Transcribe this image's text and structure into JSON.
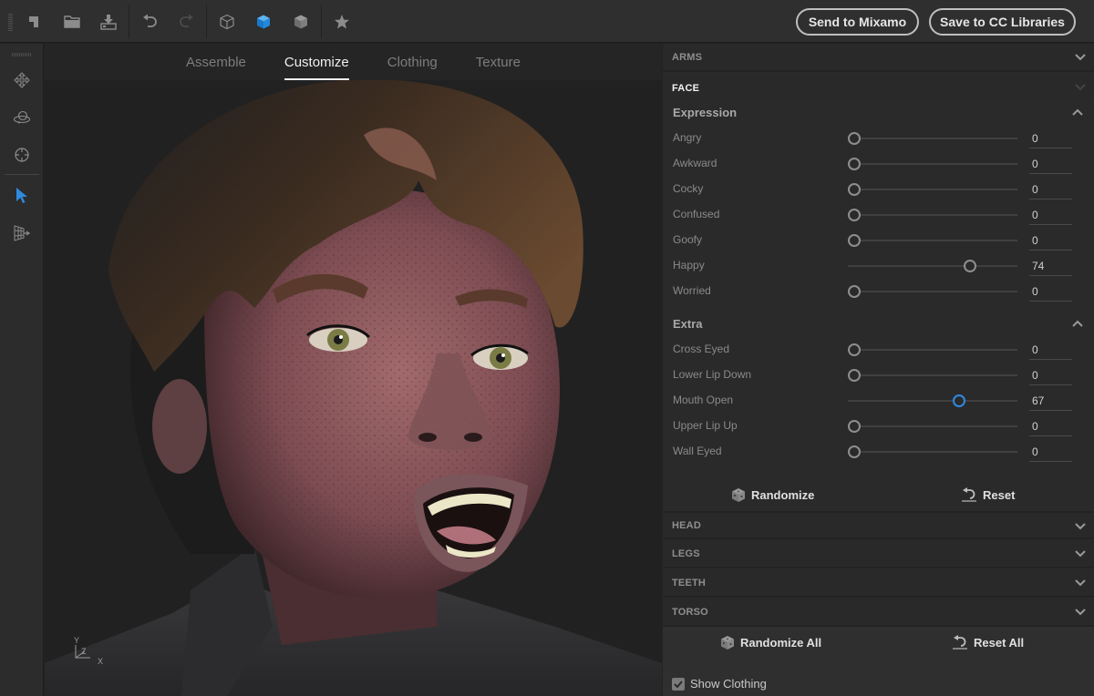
{
  "toolbar": {
    "icons": [
      "new-document-icon",
      "open-folder-icon",
      "import-icon",
      "undo-icon",
      "redo-icon",
      "wireframe-cube-icon",
      "shaded-cube-icon",
      "solid-cube-icon",
      "favorite-star-icon"
    ],
    "send_label": "Send to Mixamo",
    "save_label": "Save to CC Libraries"
  },
  "rail": {
    "icons": [
      "pan-icon",
      "orbit-icon",
      "target-icon",
      "select-arrow-icon",
      "perspective-grid-icon"
    ],
    "active": "select-arrow-icon"
  },
  "viewport": {
    "tabs": [
      {
        "label": "Assemble",
        "active": false
      },
      {
        "label": "Customize",
        "active": true
      },
      {
        "label": "Clothing",
        "active": false
      },
      {
        "label": "Texture",
        "active": false
      }
    ],
    "axes": {
      "y": "Y",
      "z": "Z",
      "x": "X"
    }
  },
  "panel": {
    "sections_top": [
      {
        "label": "ARMS",
        "open": false
      },
      {
        "label": "FACE",
        "open": true
      }
    ],
    "expression": {
      "title": "Expression",
      "sliders": [
        {
          "label": "Angry",
          "value": 0
        },
        {
          "label": "Awkward",
          "value": 0
        },
        {
          "label": "Cocky",
          "value": 0
        },
        {
          "label": "Confused",
          "value": 0
        },
        {
          "label": "Goofy",
          "value": 0
        },
        {
          "label": "Happy",
          "value": 74
        },
        {
          "label": "Worried",
          "value": 0
        }
      ]
    },
    "extra": {
      "title": "Extra",
      "sliders": [
        {
          "label": "Cross Eyed",
          "value": 0
        },
        {
          "label": "Lower Lip Down",
          "value": 0
        },
        {
          "label": "Mouth Open",
          "value": 67,
          "active": true
        },
        {
          "label": "Upper Lip Up",
          "value": 0
        },
        {
          "label": "Wall Eyed",
          "value": 0
        }
      ]
    },
    "face_actions": {
      "randomize": "Randomize",
      "reset": "Reset"
    },
    "sections_bottom": [
      {
        "label": "HEAD",
        "open": false
      },
      {
        "label": "LEGS",
        "open": false
      },
      {
        "label": "TEETH",
        "open": false
      },
      {
        "label": "TORSO",
        "open": false
      }
    ],
    "global_actions": {
      "randomize_all": "Randomize All",
      "reset_all": "Reset All"
    },
    "show_clothing": {
      "label": "Show Clothing",
      "checked": true
    }
  },
  "colors": {
    "accent": "#2f8ae0",
    "panel_bg": "#2a2a2a",
    "toolbar_bg": "#2f2f2f"
  }
}
